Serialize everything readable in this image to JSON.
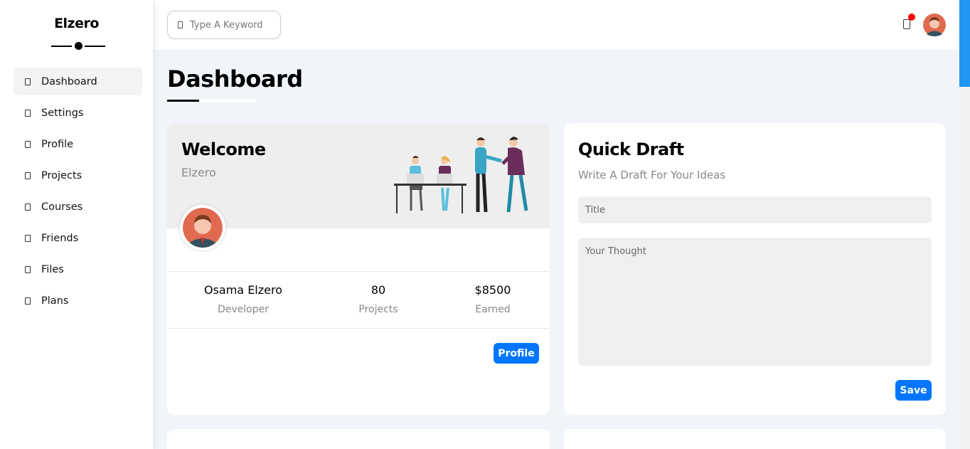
{
  "sidebar": {
    "brand": "Elzero",
    "items": [
      {
        "label": "Dashboard",
        "active": true
      },
      {
        "label": "Settings"
      },
      {
        "label": "Profile"
      },
      {
        "label": "Projects"
      },
      {
        "label": "Courses"
      },
      {
        "label": "Friends"
      },
      {
        "label": "Files"
      },
      {
        "label": "Plans"
      }
    ]
  },
  "header": {
    "search_placeholder": "Type A Keyword",
    "notification_icon": "bell-icon",
    "notification_dot_color": "#ff0000"
  },
  "page": {
    "title": "Dashboard"
  },
  "welcome": {
    "title": "Welcome",
    "subtitle": "Elzero",
    "stats": [
      {
        "value": "Osama Elzero",
        "label": "Developer"
      },
      {
        "value": "80",
        "label": "Projects"
      },
      {
        "value": "$8500",
        "label": "Earned"
      }
    ],
    "button": "Profile"
  },
  "draft": {
    "title": "Quick Draft",
    "subtitle": "Write A Draft For Your Ideas",
    "title_placeholder": "Title",
    "thought_placeholder": "Your Thought",
    "button": "Save"
  },
  "colors": {
    "accent": "#0075ff",
    "background": "#f1f5f9",
    "scroll_thumb": "#2196f3"
  }
}
